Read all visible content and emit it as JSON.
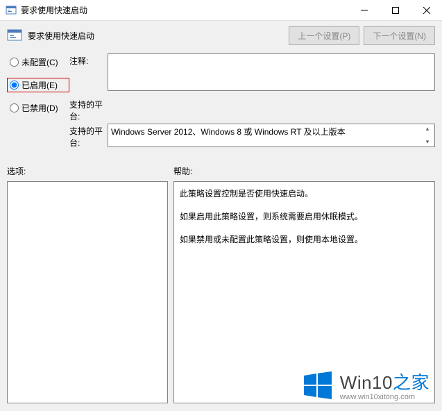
{
  "window": {
    "title": "要求使用快速启动"
  },
  "header": {
    "title": "要求使用快速启动",
    "prev_button": "上一个设置(P)",
    "next_button": "下一个设置(N)"
  },
  "radios": {
    "not_configured": "未配置(C)",
    "enabled": "已启用(E)",
    "disabled": "已禁用(D)",
    "selected": "enabled"
  },
  "comment": {
    "label": "注释:",
    "value": ""
  },
  "platform": {
    "label": "支持的平台:",
    "value": "Windows Server 2012、Windows 8 或 Windows RT 及以上版本"
  },
  "sections": {
    "options_label": "选项:",
    "help_label": "帮助:"
  },
  "help": {
    "lines": [
      "此策略设置控制是否使用快速启动。",
      "如果启用此策略设置，则系统需要启用休眠模式。",
      "如果禁用或未配置此策略设置，则使用本地设置。"
    ]
  },
  "watermark": {
    "brand_en": "Win10",
    "brand_zh": "之家",
    "url": "www.win10xitong.com"
  }
}
